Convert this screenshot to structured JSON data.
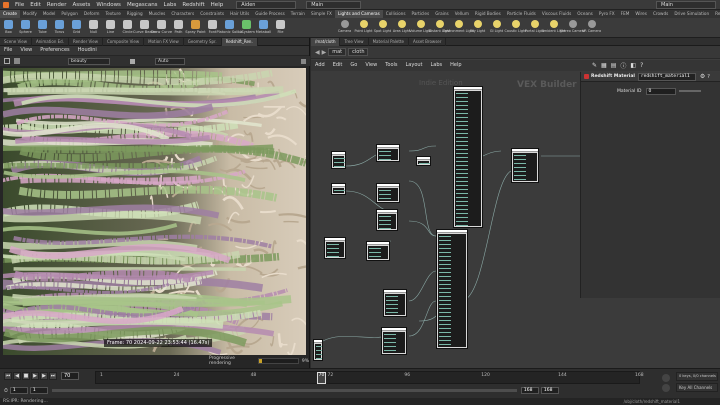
{
  "menubar": {
    "items": [
      "File",
      "Edit",
      "Render",
      "Assets",
      "Windows",
      "Megascans",
      "Labs",
      "Redshift",
      "Help"
    ],
    "desktop": "Aiden",
    "desktop2": "Main",
    "desktop3": "Main"
  },
  "shelf_tabs_left": [
    "Create",
    "Modify",
    "Model",
    "Polygon",
    "Deform",
    "Texture",
    "Rigging",
    "Muscles",
    "Characters",
    "Constraints",
    "Hair Utils",
    "Guide Process",
    "Terrain",
    "Simple FX",
    "Volume",
    "Personal"
  ],
  "shelf_tabs_right": [
    "Lights and Cameras",
    "Collisions",
    "Particles",
    "Grains",
    "Vellum",
    "Rigid Bodies",
    "Particle Fluids",
    "Viscous Fluids",
    "Oceans",
    "Pyro FX",
    "FEM",
    "Wires",
    "Crowds",
    "Drive Simulation",
    "Redshift"
  ],
  "shelf_tools_left": [
    {
      "label": "Box",
      "color": "#6aa0d8"
    },
    {
      "label": "Sphere",
      "color": "#6aa0d8"
    },
    {
      "label": "Tube",
      "color": "#6aa0d8"
    },
    {
      "label": "Torus",
      "color": "#6aa0d8"
    },
    {
      "label": "Grid",
      "color": "#6aa0d8"
    },
    {
      "label": "Null",
      "color": "#c8c8c8"
    },
    {
      "label": "Line",
      "color": "#c8c8c8"
    },
    {
      "label": "Circle",
      "color": "#c8c8c8"
    },
    {
      "label": "Curve Bezier",
      "color": "#c8c8c8"
    },
    {
      "label": "Draw Curve",
      "color": "#c8c8c8"
    },
    {
      "label": "Path",
      "color": "#c8c8c8"
    },
    {
      "label": "Spray Paint",
      "color": "#d89a3c"
    },
    {
      "label": "Font",
      "color": "#c8c8c8"
    },
    {
      "label": "Platonic Solids",
      "color": "#6aa0d8"
    },
    {
      "label": "L-System",
      "color": "#6ac06a"
    },
    {
      "label": "Metaball",
      "color": "#6aa0d8"
    },
    {
      "label": "File",
      "color": "#c8c8c8"
    }
  ],
  "shelf_tools_right": [
    {
      "label": "Camera",
      "color": "#999999"
    },
    {
      "label": "Point Light",
      "color": "#e8d36a"
    },
    {
      "label": "Spot Light",
      "color": "#e8d36a"
    },
    {
      "label": "Area Light",
      "color": "#e8d36a"
    },
    {
      "label": "Volume Light",
      "color": "#e8d36a"
    },
    {
      "label": "Distant Light",
      "color": "#e8d36a"
    },
    {
      "label": "Environment Light",
      "color": "#e8d36a"
    },
    {
      "label": "Sky Light",
      "color": "#e8d36a"
    },
    {
      "label": "GI Light",
      "color": "#e8d36a"
    },
    {
      "label": "Caustic Light",
      "color": "#e8d36a"
    },
    {
      "label": "Portal Light",
      "color": "#e8d36a"
    },
    {
      "label": "Ambient Light",
      "color": "#e8d36a"
    },
    {
      "label": "Stereo Camera",
      "color": "#999999"
    },
    {
      "label": "VR Camera",
      "color": "#999999"
    }
  ],
  "render_pane": {
    "tabs": [
      "Scene View",
      "Animation Ed.",
      "Render View",
      "Composite View",
      "Motion FX View",
      "Geometry Spr.",
      "Redshift_Ren."
    ],
    "menu": [
      "File",
      "View",
      "Preferences",
      "Houdini"
    ],
    "aov": "beauty",
    "zoom": "Auto",
    "frame_info": "Frame: 70  2024-09-22  23:53:44  (16.47s)",
    "progress_label": "Progressive rendering",
    "progress_value": "9%",
    "progress_fraction": 0.09
  },
  "net_pane": {
    "tabs": [
      "/mat/cloth",
      "Tree View",
      "Material Palette",
      "Asset Browser"
    ],
    "path": [
      "mat",
      "cloth"
    ],
    "menu": [
      "Add",
      "Edit",
      "Go",
      "View",
      "Tools",
      "Layout",
      "Labs",
      "Help"
    ],
    "watermark": "Indie Edition",
    "builder_label": "VEX Builder"
  },
  "param_panel": {
    "type_label": "Redshift Material",
    "name": "redshift_material1",
    "param_label": "Material ID",
    "param_value": "0"
  },
  "timeline": {
    "frame": "70",
    "start": "1",
    "start2": "1",
    "end": "168",
    "end2": "168",
    "ticks": [
      "1",
      "24",
      "48",
      "72",
      "96",
      "120",
      "144",
      "168"
    ],
    "current_marker": "70",
    "keys_label": "0 keys, 0/0 channels",
    "key_all_label": "Key All Channels",
    "path_label": "/obj/cloth/redshift_material1"
  },
  "status": "RS:IPR: Rendering..."
}
